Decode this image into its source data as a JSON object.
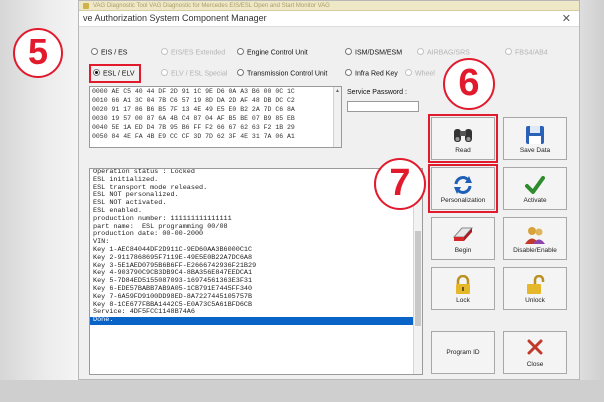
{
  "taskbar": {
    "items": [
      "VAG Diagnostic Tool",
      "VAG Diagnostic for Mercedes EIS/ESL",
      "Open and Start Monitor",
      "VAG"
    ]
  },
  "window": {
    "title": "ve Authorization System Component Manager",
    "close_glyph": "✕"
  },
  "radios": {
    "eis_es": "EIS / ES",
    "eis_es_disabled": "EIS/ES Extended",
    "engine_cu": "Engine Control Unit",
    "isn_esm": "ISM/DSM/ESM",
    "ism_other": "AIRBAG/SRS",
    "fbs_other": "FBS4/AB4",
    "esl_elv": "ESL / ELV",
    "elv_disabled": "ELV / ESL Special",
    "transmission_cu": "Transmission Control Unit",
    "infrared_key": "Infra Red Key",
    "other_disabled": "Wheel"
  },
  "hex_dump": [
    "0000 AE C5 40 44 DF 2D 91 1C 9E D6 0A A3 B6 00 0C 1C",
    "0010 66 A1 3C 04 7B C6 57 19 8D DA 2D AF 48 DB DC C2",
    "0020 91 17 86 B6 B5 7F 13 4E 49 E5 E0 B2 2A 7D C6 8A",
    "0030 19 57 00 87 6A 4B C4 87 04 AF B5 BE 07 B9 85 EB",
    "0040 5E 1A ED D4 7B 95 B6 FF F2 66 67 62 63 F2 1B 29",
    "0050 84 4E FA 4B E9 CC CF 3D 7D 62 3F 4E 31 7A 06 A1"
  ],
  "service_password": {
    "label": "Service Password :",
    "value": ""
  },
  "log_lines": [
    "Operation status : Locked",
    "ESL initialized.",
    "ESL transport mode released.",
    "ESL NOT personalized.",
    "ESL NOT activated.",
    "ESL enabled.",
    "production number: 111111111111111",
    "part name:  ESL programming 00/08",
    "production date: 00-00-2000",
    "VIN:",
    "Key 1-AEC84044DF2D911C-9ED60AA3B6000C1C",
    "Key 2-9117868695F7119E-49E5E0B22A7DC6A8",
    "Key 3-5E1AED0795B6B6FF-E2666742936F21B29",
    "Key 4-903790C9CB3DB9C4-8BA356E847EEDCA1",
    "Key 5-7D84ED5155087093-16974561363E3F31",
    "Key 6-EDE57BABB7AB9A05-1CB791E7445FF340",
    "Key 7-6A59FD9100DD98ED-8A7227445105757B",
    "Key 8-1CE677FBBA1442C5-E0A73C5A61BFD6CB",
    "Service: 4DF5FCC1148B74A6",
    "Done."
  ],
  "buttons": {
    "read": "Read",
    "save_data": "Save Data",
    "personalization": "Personalization",
    "activate": "Activate",
    "begin": "Begin",
    "disable_enable": "Disable/Enable",
    "lock": "Lock",
    "unlock": "Unlock",
    "program_id": "Program ID",
    "close": "Close"
  },
  "annotations": {
    "step5": "5",
    "step6": "6",
    "step7": "7"
  },
  "colors": {
    "annotation_red": "#e11b2d",
    "selection_blue": "#0a64c8"
  }
}
